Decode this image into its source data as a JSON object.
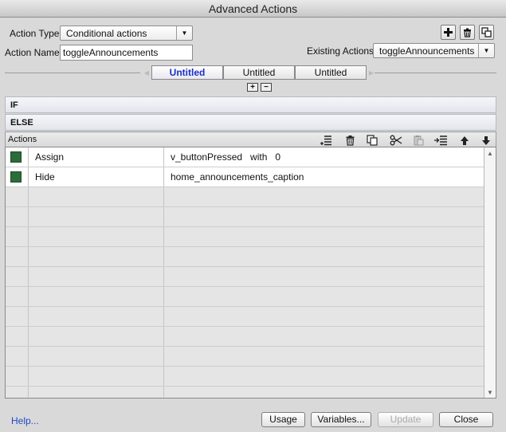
{
  "window": {
    "title": "Advanced Actions"
  },
  "form": {
    "action_type_label": "Action Type:",
    "action_type_value": "Conditional actions",
    "action_name_label": "Action Name:",
    "action_name_value": "toggleAnnouncements",
    "existing_actions_label": "Existing Actions:",
    "existing_actions_value": "toggleAnnouncements"
  },
  "top_icons": [
    "add-icon",
    "trash-icon",
    "duplicate-icon"
  ],
  "tabs": [
    {
      "label": "Untitled",
      "active": true
    },
    {
      "label": "Untitled",
      "active": false
    },
    {
      "label": "Untitled",
      "active": false
    }
  ],
  "tab_controls": {
    "add": "+",
    "remove": "−"
  },
  "sections": {
    "if_label": "IF",
    "else_label": "ELSE"
  },
  "actions": {
    "header_label": "Actions",
    "toolbar_icons": [
      "insert-row-icon",
      "trash-icon",
      "copy-icon",
      "cut-icon",
      "paste-icon",
      "insert-after-icon",
      "move-up-icon",
      "move-down-icon"
    ],
    "rows": [
      {
        "action": "Assign",
        "target": "v_buttonPressed   with   0",
        "swatch": "#2c6b3a"
      },
      {
        "action": "Hide",
        "target": "home_announcements_caption",
        "swatch": "#2c6b3a"
      }
    ]
  },
  "footer": {
    "help_label": "Help...",
    "usage_label": "Usage",
    "variables_label": "Variables...",
    "update_label": "Update",
    "close_label": "Close"
  },
  "colors": {
    "accent_tab": "#1b2ec9",
    "link": "#2148c8",
    "swatch": "#2c6b3a"
  }
}
